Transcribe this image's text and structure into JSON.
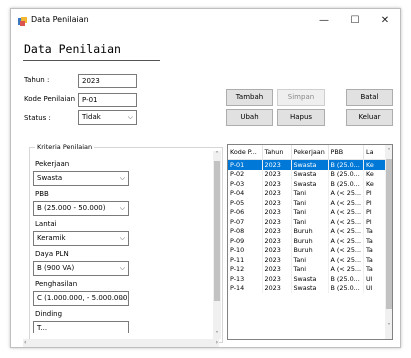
{
  "window": {
    "title": "Data Penilaian",
    "controls": {
      "minimize": "—",
      "maximize": "☐",
      "close": "✕"
    }
  },
  "heading": "Data Penilaian",
  "form": {
    "tahun_label": "Tahun :",
    "tahun_value": "2023",
    "kode_label": "Kode Penilaian :",
    "kode_value": "P-01",
    "status_label": "Status :",
    "status_value": "Tidak"
  },
  "buttons": {
    "tambah": "Tambah",
    "simpan": "Simpan",
    "batal": "Batal",
    "ubah": "Ubah",
    "hapus": "Hapus",
    "keluar": "Keluar"
  },
  "kriteria": {
    "title": "Kriteria Penilaian",
    "fields": [
      {
        "label": "Pekerjaan",
        "value": "Swasta"
      },
      {
        "label": "PBB",
        "value": "B (25.000 - 50.000)"
      },
      {
        "label": "Lantai",
        "value": "Keramik"
      },
      {
        "label": "Daya PLN",
        "value": "B (900 VA)"
      },
      {
        "label": "Penghasilan",
        "value": "C (1.000.000, - 5.000.000,)"
      },
      {
        "label": "Dinding",
        "value": ""
      }
    ],
    "partial_value": "T..."
  },
  "grid": {
    "columns": [
      "Kode P...",
      "Tahun",
      "Pekerjaan",
      "PBB",
      "La"
    ],
    "rows": [
      [
        "P-01",
        "2023",
        "Swasta",
        "B (25.0...",
        "Ke"
      ],
      [
        "P-02",
        "2023",
        "Swasta",
        "B (25.0...",
        "Ke"
      ],
      [
        "P-03",
        "2023",
        "Swasta",
        "B (25.0...",
        "Ke"
      ],
      [
        "P-04",
        "2023",
        "Tani",
        "A (< 25...",
        "Pl"
      ],
      [
        "P-05",
        "2023",
        "Tani",
        "A (< 25...",
        "Pl"
      ],
      [
        "P-06",
        "2023",
        "Tani",
        "A (< 25...",
        "Pl"
      ],
      [
        "P-07",
        "2023",
        "Tani",
        "A (< 25...",
        "Pl"
      ],
      [
        "P-08",
        "2023",
        "Buruh",
        "A (< 25...",
        "Ta"
      ],
      [
        "P-09",
        "2023",
        "Buruh",
        "A (< 25...",
        "Ta"
      ],
      [
        "P-10",
        "2023",
        "Buruh",
        "A (< 25...",
        "Ta"
      ],
      [
        "P-11",
        "2023",
        "Tani",
        "A (< 25...",
        "Ta"
      ],
      [
        "P-12",
        "2023",
        "Tani",
        "A (< 25...",
        "Ta"
      ],
      [
        "P-13",
        "2023",
        "Swasta",
        "B (25.0...",
        "Ul"
      ],
      [
        "P-14",
        "2023",
        "Swasta",
        "B (25.0...",
        "Ul"
      ]
    ],
    "selected_row": 0
  },
  "colors": {
    "selection": "#0078d7",
    "focus_border": "#0078d7"
  },
  "icons": {
    "app": "app-icon",
    "combo_arrow": "chevron-down-icon"
  }
}
